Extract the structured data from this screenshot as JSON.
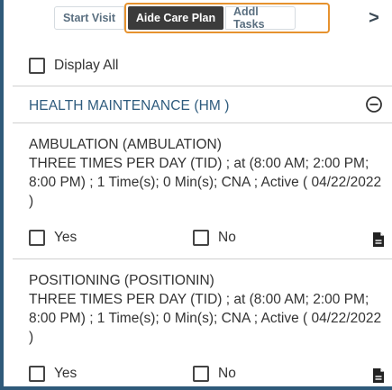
{
  "tabs": {
    "start_visit": "Start Visit",
    "aide_care_plan": "Aide Care Plan",
    "addl_tasks": "Addl Tasks",
    "next_glyph": ">"
  },
  "filter": {
    "display_all_label": "Display All",
    "display_all_checked": false
  },
  "section": {
    "title": "HEALTH MAINTENANCE (HM )",
    "collapse_icon": "minus-circle-icon"
  },
  "tasks": [
    {
      "title": "AMBULATION (AMBULATION)",
      "detail": "THREE TIMES PER DAY (TID) ; at (8:00 AM; 2:00 PM; 8:00 PM) ; 1 Time(s); 0 Min(s); CNA ; Active ( 04/22/2022 )",
      "yes_label": "Yes",
      "no_label": "No",
      "yes_checked": false,
      "no_checked": false
    },
    {
      "title": "POSITIONING (POSITIONIN)",
      "detail": "THREE TIMES PER DAY (TID) ; at (8:00 AM; 2:00 PM; 8:00 PM) ; 1 Time(s); 0 Min(s); CNA ; Active ( 04/22/2022 )",
      "yes_label": "Yes",
      "no_label": "No",
      "yes_checked": false,
      "no_checked": false
    }
  ],
  "colors": {
    "accent": "#e6922e",
    "active_tab": "#3b3b3b",
    "section_header": "#2e5b7d",
    "frame": "#2f5a7a"
  }
}
